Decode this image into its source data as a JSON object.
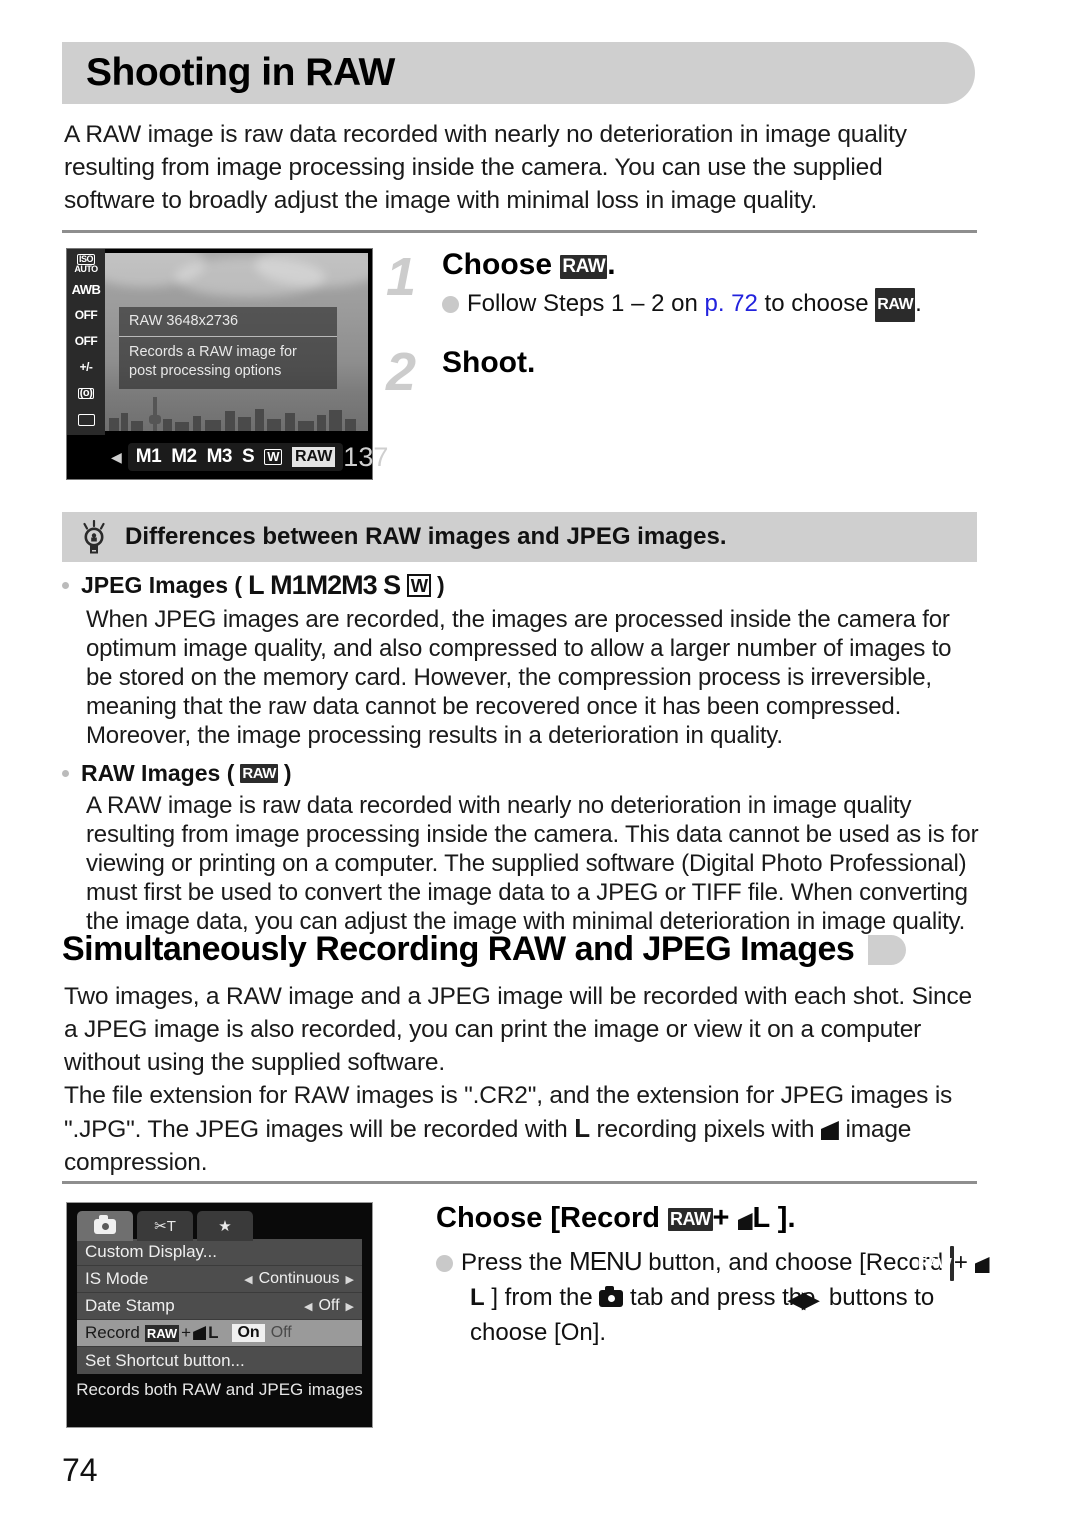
{
  "page": {
    "number": "74",
    "chapter_title": "Shooting in RAW",
    "intro": "A RAW image is raw data recorded with nearly no deterioration in image quality resulting from image processing inside the camera. You can use the supplied software to broadly adjust the image with minimal loss in image quality."
  },
  "colors": {
    "band": "#cfcfcf",
    "rule": "#8e8e8e",
    "link": "#2222dd",
    "step_number": "#cccccc",
    "text": "#1a1a1a"
  },
  "procedure_1": {
    "step1": {
      "number": "1",
      "heading_prefix": "Choose ",
      "heading_icon": "RAW",
      "heading_suffix": ".",
      "bullet_a": "Follow Steps 1 – 2 on ",
      "bullet_link": "p. 72",
      "bullet_b": " to choose ",
      "bullet_icon": "RAW",
      "bullet_c": "."
    },
    "step2": {
      "number": "2",
      "heading": "Shoot."
    }
  },
  "lcd_shot": {
    "rail": [
      {
        "line1": "ISO",
        "line2": "AUTO"
      },
      {
        "line1": "AWB",
        "line2": ""
      },
      {
        "line1": "OFF",
        "line2": ""
      },
      {
        "line1": "OFF",
        "line2": ""
      },
      {
        "line1": "+/-",
        "line2": ""
      },
      {
        "line1": "(o)",
        "line2": ""
      },
      {
        "line1": "",
        "line2": ""
      }
    ],
    "rail_selected": "RAW",
    "info_title": "RAW 3648x2736",
    "info_desc_line1": "Records a RAW image for",
    "info_desc_line2": "post processing options",
    "selector": [
      "M1",
      "M2",
      "M3",
      "S",
      "W"
    ],
    "selector_active": "RAW",
    "shots_remaining": "137"
  },
  "tip": {
    "icon": "lightbulb-icon",
    "title": "Differences between RAW images and JPEG images.",
    "jpeg": {
      "label": "JPEG Images (",
      "icons": [
        "L",
        "M1",
        "M2",
        "M3",
        "S",
        "W"
      ],
      "label_close": ")",
      "body": "When JPEG images are recorded, the images are processed inside the camera for optimum image quality, and also compressed to allow a larger number of images to be stored on the memory card. However, the compression process is irreversible, meaning that the raw data cannot be recovered once it has been compressed. Moreover, the image processing results in a deterioration in quality."
    },
    "raw": {
      "label": "RAW Images (",
      "icon": "RAW",
      "label_close": ")",
      "body": "A RAW image is raw data recorded with nearly no deterioration in image quality resulting from image processing inside the camera. This data cannot be used as is for viewing or printing on a computer. The supplied software (Digital Photo Professional) must first be used to convert the image data to a JPEG or TIFF file. When converting the image data, you can adjust the image with minimal deterioration in image quality."
    }
  },
  "section2": {
    "heading": "Simultaneously Recording RAW and JPEG Images",
    "badge": "page-tab-badge",
    "para1": "Two images, a RAW image and a JPEG image will be recorded with each shot. Since a JPEG image is also recorded, you can print the image or view it on a computer without using the supplied software.",
    "para2_a": "The file extension for RAW images is \".CR2\", and the extension for JPEG images is \".JPG\". The JPEG images will be recorded with ",
    "para2_icon_l": "L",
    "para2_b": " recording pixels with ",
    "para2_icon_wedge": "fine-compression-icon",
    "para2_c": " image compression."
  },
  "menu_shot": {
    "tabs": [
      "camera-tab",
      "tools-tab",
      "star-tab"
    ],
    "active_tab": "camera-tab",
    "rows": [
      {
        "label": "Custom Display...",
        "value": "",
        "type": "submenu"
      },
      {
        "label": "IS Mode",
        "value": "Continuous",
        "type": "spin"
      },
      {
        "label": "Date Stamp",
        "value": "Off",
        "type": "spin"
      },
      {
        "label": "Record ",
        "label_icons": "RAW + L",
        "value": "On",
        "value_alt": "Off",
        "type": "toggle",
        "selected": true
      },
      {
        "label": "Set Shortcut button...",
        "value": "",
        "type": "submenu"
      }
    ],
    "footer": "Records both RAW and JPEG images"
  },
  "procedure_2": {
    "heading_a": "Choose [Record ",
    "heading_icon_raw": "RAW",
    "heading_plus": "+ ",
    "heading_icon_l": "L",
    "heading_b": " ].",
    "bullet_a": "Press the ",
    "bullet_menu": "MENU",
    "bullet_b": " button, and choose [Record ",
    "bullet_icon_raw": "RAW",
    "bullet_plus": "+ ",
    "bullet_icon_l": "L",
    "bullet_c": " ] from the ",
    "bullet_icon_cam": "camera-tab-icon",
    "bullet_d": " tab and press the ",
    "bullet_icon_lr": "left-right-buttons-icon",
    "bullet_e": " buttons to choose [On]."
  }
}
